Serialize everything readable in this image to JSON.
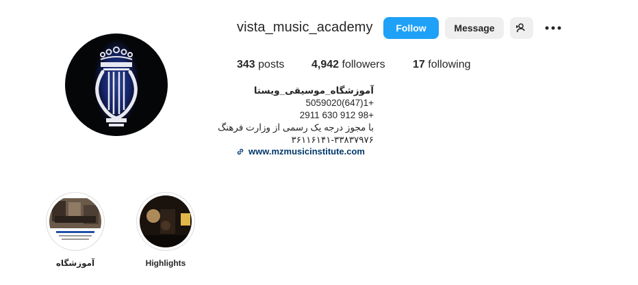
{
  "profile": {
    "username": "vista_music_academy",
    "avatar_icon": "lyre-crown-logo-icon"
  },
  "actions": {
    "follow_label": "Follow",
    "message_label": "Message",
    "add_person_icon": "person-add-icon",
    "more_icon": "more-options-icon"
  },
  "stats": {
    "posts_count": "343",
    "posts_label": "posts",
    "followers_count": "4,942",
    "followers_label": "followers",
    "following_count": "17",
    "following_label": "following"
  },
  "bio": {
    "lines": [
      "آموزشگاه_موسیقی_ویستا",
      "5059020(647)1+",
      "2911 630 912 98+",
      "با مجوز درجه یک رسمی از وزارت فرهنگ",
      "۳۶۱۱۶۱۴۱-۳۳۸۳۷۹۷۶"
    ],
    "website": "www.mzmusicinstitute.com",
    "link_icon": "link-icon"
  },
  "highlights": [
    {
      "label": "آموزشگاه"
    },
    {
      "label": "Highlights"
    }
  ],
  "colors": {
    "follow_button": "#1ea1f6",
    "secondary_button": "#efefef",
    "link": "#00376b",
    "text": "#262626"
  }
}
